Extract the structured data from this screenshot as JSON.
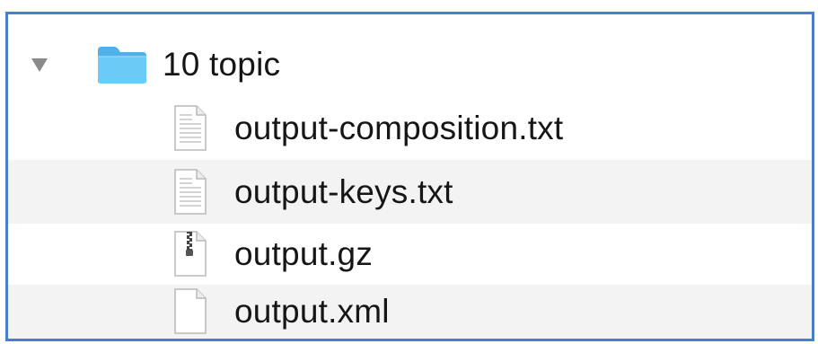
{
  "folder": {
    "name": "10 topic",
    "expanded": true,
    "icon": "folder-icon",
    "color": "#63c0f2"
  },
  "files": [
    {
      "name": "output-composition.txt",
      "icon": "text-document-icon"
    },
    {
      "name": "output-keys.txt",
      "icon": "text-document-icon"
    },
    {
      "name": "output.gz",
      "icon": "archive-zipper-icon"
    },
    {
      "name": "output.xml",
      "icon": "blank-document-icon"
    }
  ],
  "colors": {
    "frame_border": "#4a7ecb",
    "alt_row": "#f3f3f3",
    "disclosure": "#8a8a8a"
  }
}
